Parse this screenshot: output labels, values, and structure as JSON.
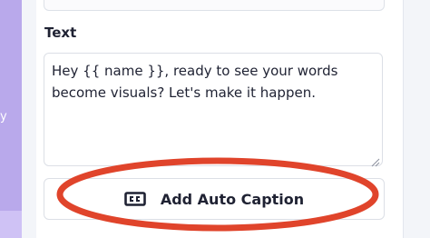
{
  "sidebar": {
    "partial_text": "y"
  },
  "editor": {
    "section_label": "Text",
    "text_value": "Hey {{ name }}, ready to see your words become visuals? Let's make it happen.",
    "button_label": "Add Auto Caption",
    "button_icon": "closed-captions-icon"
  },
  "colors": {
    "sidebar_accent": "#b9a9eb",
    "highlight_ring": "#e0442b"
  }
}
